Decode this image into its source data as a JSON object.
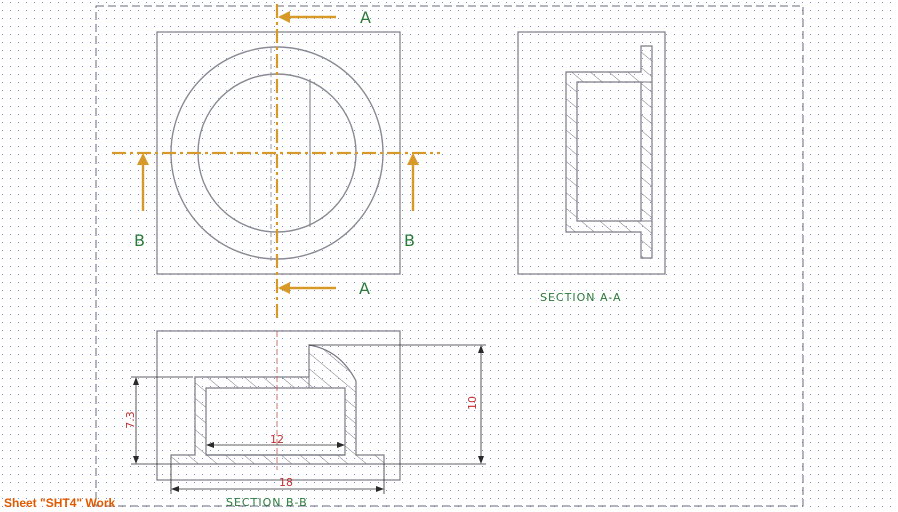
{
  "section_marks": {
    "a_top": "A",
    "a_bottom": "A",
    "b_left": "B",
    "b_right": "B"
  },
  "view_titles": {
    "section_aa": "SECTION A-A",
    "section_bb": "SECTION B-B"
  },
  "dimensions": {
    "height_left": "7.3",
    "height_right": "10",
    "inner_width": "12",
    "overall_width": "18"
  },
  "status_text": "Sheet \"SHT4\" Work",
  "colors": {
    "grid": "#5a73c8",
    "geometry": "#7a7a84",
    "section_line": "#d79a28",
    "label": "#2a7a3a",
    "dimension": "#c03030",
    "status": "#e05a00"
  }
}
